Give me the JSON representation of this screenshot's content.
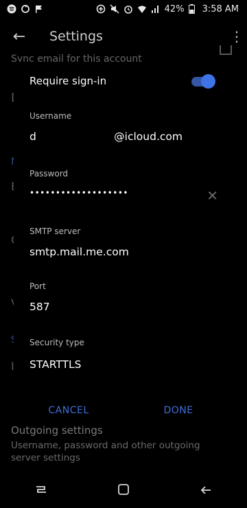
{
  "status": {
    "battery": "42%",
    "time": "3:58 AM"
  },
  "appbar": {
    "title": "Settings"
  },
  "background": {
    "top_line": "Sync email for this account",
    "below_title": "Outgoing settings",
    "below_sub": "Username, password and other outgoing server settings"
  },
  "dialog": {
    "signin_label": "Require sign-in",
    "signin_on": true,
    "username_label": "Username",
    "username_value": "d                       @icloud.com",
    "password_label": "Password",
    "password_value": "•••••••••••••••••••",
    "smtp_label": "SMTP server",
    "smtp_value": "smtp.mail.me.com",
    "port_label": "Port",
    "port_value": "587",
    "security_label": "Security type",
    "security_value": "STARTTLS",
    "cancel_label": "CANCEL",
    "done_label": "DONE"
  },
  "colors": {
    "accent": "#3f6fd8",
    "toggle_thumb": "#3f74e8"
  },
  "icons": {
    "back": "arrow-back-icon",
    "more": "more-vert-icon",
    "clear": "clear-icon"
  }
}
